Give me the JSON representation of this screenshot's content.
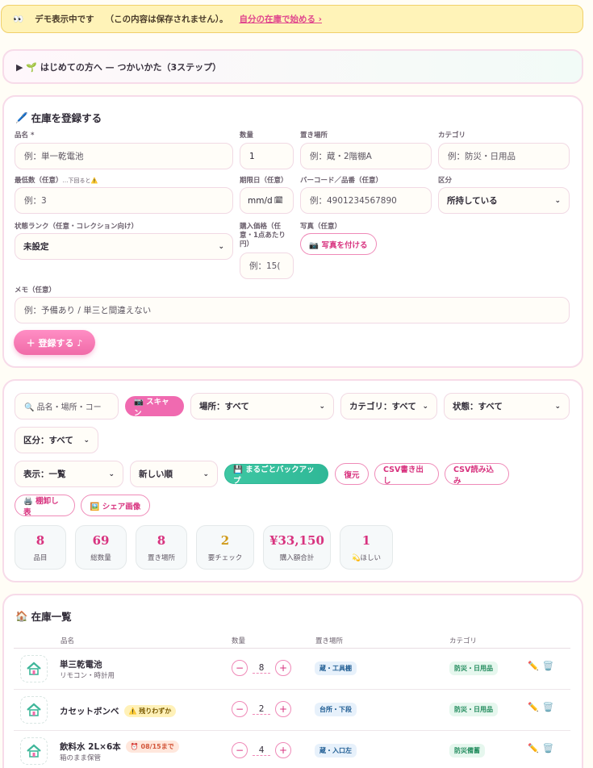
{
  "banner": {
    "eyes": "👀",
    "text1": "デモ表示中です",
    "text2": "（この内容は保存されません）。",
    "link": "自分の在庫で始める ›"
  },
  "guide": {
    "text": "▶ 🌱 はじめての方へ — つかいかた（3ステップ）"
  },
  "register": {
    "title_icon": "🖊️",
    "title": "在庫を登録する",
    "name_label": "品名 *",
    "name_ph": "例：単一乾電池",
    "qty_label": "数量",
    "qty_val": "1",
    "place_label": "置き場所",
    "place_ph": "例：蔵・2階棚A",
    "cat_label": "カテゴリ",
    "cat_ph": "例：防災・日用品",
    "min_label": "最低数（任意）",
    "min_note": "…下回ると⚠️",
    "min_ph": "例：3",
    "date_label": "期限日（任意）",
    "date_ph": "mm/d",
    "barcode_label": "バーコード／品番（任意）",
    "barcode_ph": "例：4901234567890",
    "kubun_label": "区分",
    "kubun_val": "所持している",
    "rank_label": "状態ランク（任意・コレクション向け）",
    "rank_val": "未設定",
    "price_label": "購入価格（任意・1点あたり円）",
    "price_ph": "例：15(",
    "photo_label": "写真（任意）",
    "photo_btn": "📷 写真を付ける",
    "memo_label": "メモ（任意）",
    "memo_ph": "例：予備あり / 単三と間違えない",
    "submit": "＋ 登録する ♪"
  },
  "filters": {
    "search_ph": "🔍 品名・場所・コー",
    "scan": "📷 スキャン",
    "place": "場所：すべて",
    "cat": "カテゴリ：すべて",
    "state": "状態：すべて",
    "kubun": "区分：すべて",
    "view": "表示：一覧",
    "sort": "新しい順",
    "backup": "💾 まるごとバックアップ",
    "restore": "復元",
    "csv_out": "CSV書き出し",
    "csv_in": "CSV読み込み",
    "shelf": "🖨️ 棚卸し表",
    "share": "🖼️ シェア画像"
  },
  "stats": [
    {
      "n": "8",
      "t": "品目"
    },
    {
      "n": "69",
      "t": "総数量"
    },
    {
      "n": "8",
      "t": "置き場所"
    },
    {
      "n": "2",
      "t": "要チェック"
    },
    {
      "n": "¥33,150",
      "t": "購入額合計"
    },
    {
      "n": "1",
      "t": "💫ほしい"
    }
  ],
  "list": {
    "title_icon": "🏠",
    "title": "在庫一覧",
    "headers": {
      "name": "品名",
      "qty": "数量",
      "place": "置き場所",
      "cat": "カテゴリ"
    },
    "rows": [
      {
        "name": "単三乾電池",
        "sub": "リモコン・時計用",
        "badge": "",
        "qty": "8",
        "place": "蔵・工具棚",
        "cat": "防災・日用品"
      },
      {
        "name": "カセットボンベ",
        "sub": "",
        "badge": "⚠️ 残りわずか",
        "qty": "2",
        "place": "台所・下段",
        "cat": "防災・日用品"
      },
      {
        "name": "飲料水 2L×6本",
        "sub": "箱のまま保管",
        "badge": "⏰ 08/15まで",
        "qty": "4",
        "place": "蔵・入口左",
        "cat": "防災備蓄"
      }
    ]
  },
  "colors": {
    "accent": "#f06ab0",
    "green": "#2fb897",
    "banner": "#fff3b8"
  }
}
